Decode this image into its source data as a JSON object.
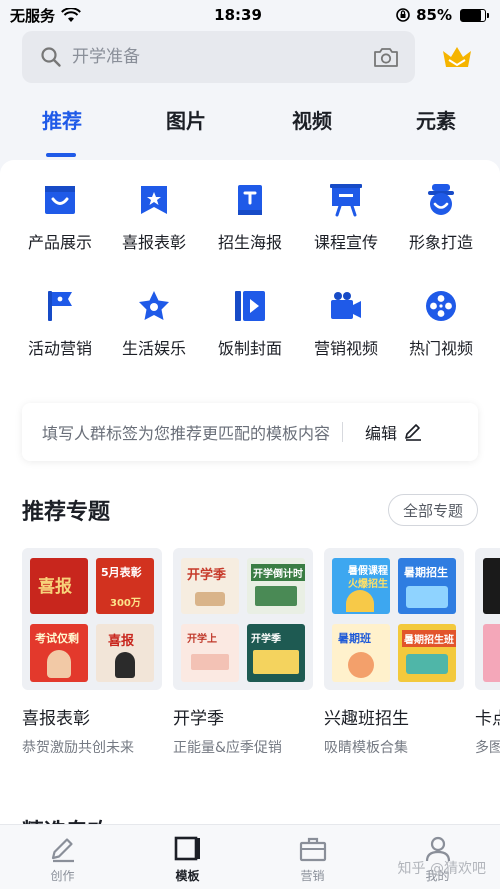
{
  "status": {
    "carrier": "无服务",
    "time": "18:39",
    "battery": "85%",
    "battery_level": 0.85
  },
  "search": {
    "placeholder": "开学准备"
  },
  "tabs": [
    {
      "label": "推荐",
      "active": true
    },
    {
      "label": "图片",
      "active": false
    },
    {
      "label": "视频",
      "active": false
    },
    {
      "label": "元素",
      "active": false
    }
  ],
  "categories": [
    {
      "label": "产品展示",
      "icon": "product-display-icon"
    },
    {
      "label": "喜报表彰",
      "icon": "good-news-icon"
    },
    {
      "label": "招生海报",
      "icon": "enrollment-poster-icon"
    },
    {
      "label": "课程宣传",
      "icon": "course-promo-icon"
    },
    {
      "label": "形象打造",
      "icon": "image-building-icon"
    },
    {
      "label": "活动营销",
      "icon": "event-marketing-icon"
    },
    {
      "label": "生活娱乐",
      "icon": "lifestyle-icon"
    },
    {
      "label": "饭制封面",
      "icon": "fan-cover-icon"
    },
    {
      "label": "营销视频",
      "icon": "marketing-video-icon"
    },
    {
      "label": "热门视频",
      "icon": "hot-video-icon"
    }
  ],
  "tag_prompt": {
    "text": "填写人群标签为您推荐更匹配的模板内容",
    "edit_label": "编辑"
  },
  "recommend": {
    "title": "推荐专题",
    "all_label": "全部专题",
    "cards": [
      {
        "title": "喜报表彰",
        "subtitle": "恭贺激励共创未来",
        "thumb_texts": [
          "喜报",
          "5月表彰",
          "300万",
          "考试仅剩",
          "喜报"
        ]
      },
      {
        "title": "开学季",
        "subtitle": "正能量&应季促销",
        "thumb_texts": [
          "开学季",
          "开学倒计时",
          "开学上",
          "开学季"
        ]
      },
      {
        "title": "兴趣班招生",
        "subtitle": "吸睛模板合集",
        "thumb_texts": [
          "暑假课程",
          "火爆招生",
          "暑期招生",
          "暑期班",
          "暑期招生班"
        ]
      },
      {
        "title": "卡点",
        "subtitle": "多图",
        "thumb_texts": []
      }
    ]
  },
  "next_section": {
    "title": "精选专攻"
  },
  "bottom_nav": [
    {
      "label": "创作",
      "icon": "pencil-icon",
      "active": false
    },
    {
      "label": "模板",
      "icon": "template-icon",
      "active": true
    },
    {
      "label": "营销",
      "icon": "briefcase-icon",
      "active": false
    },
    {
      "label": "我的",
      "icon": "person-icon",
      "active": false
    }
  ],
  "watermark": "知乎 @猜欢吧",
  "colors": {
    "accent": "#1f5ae8",
    "gold": "#f5b400"
  }
}
